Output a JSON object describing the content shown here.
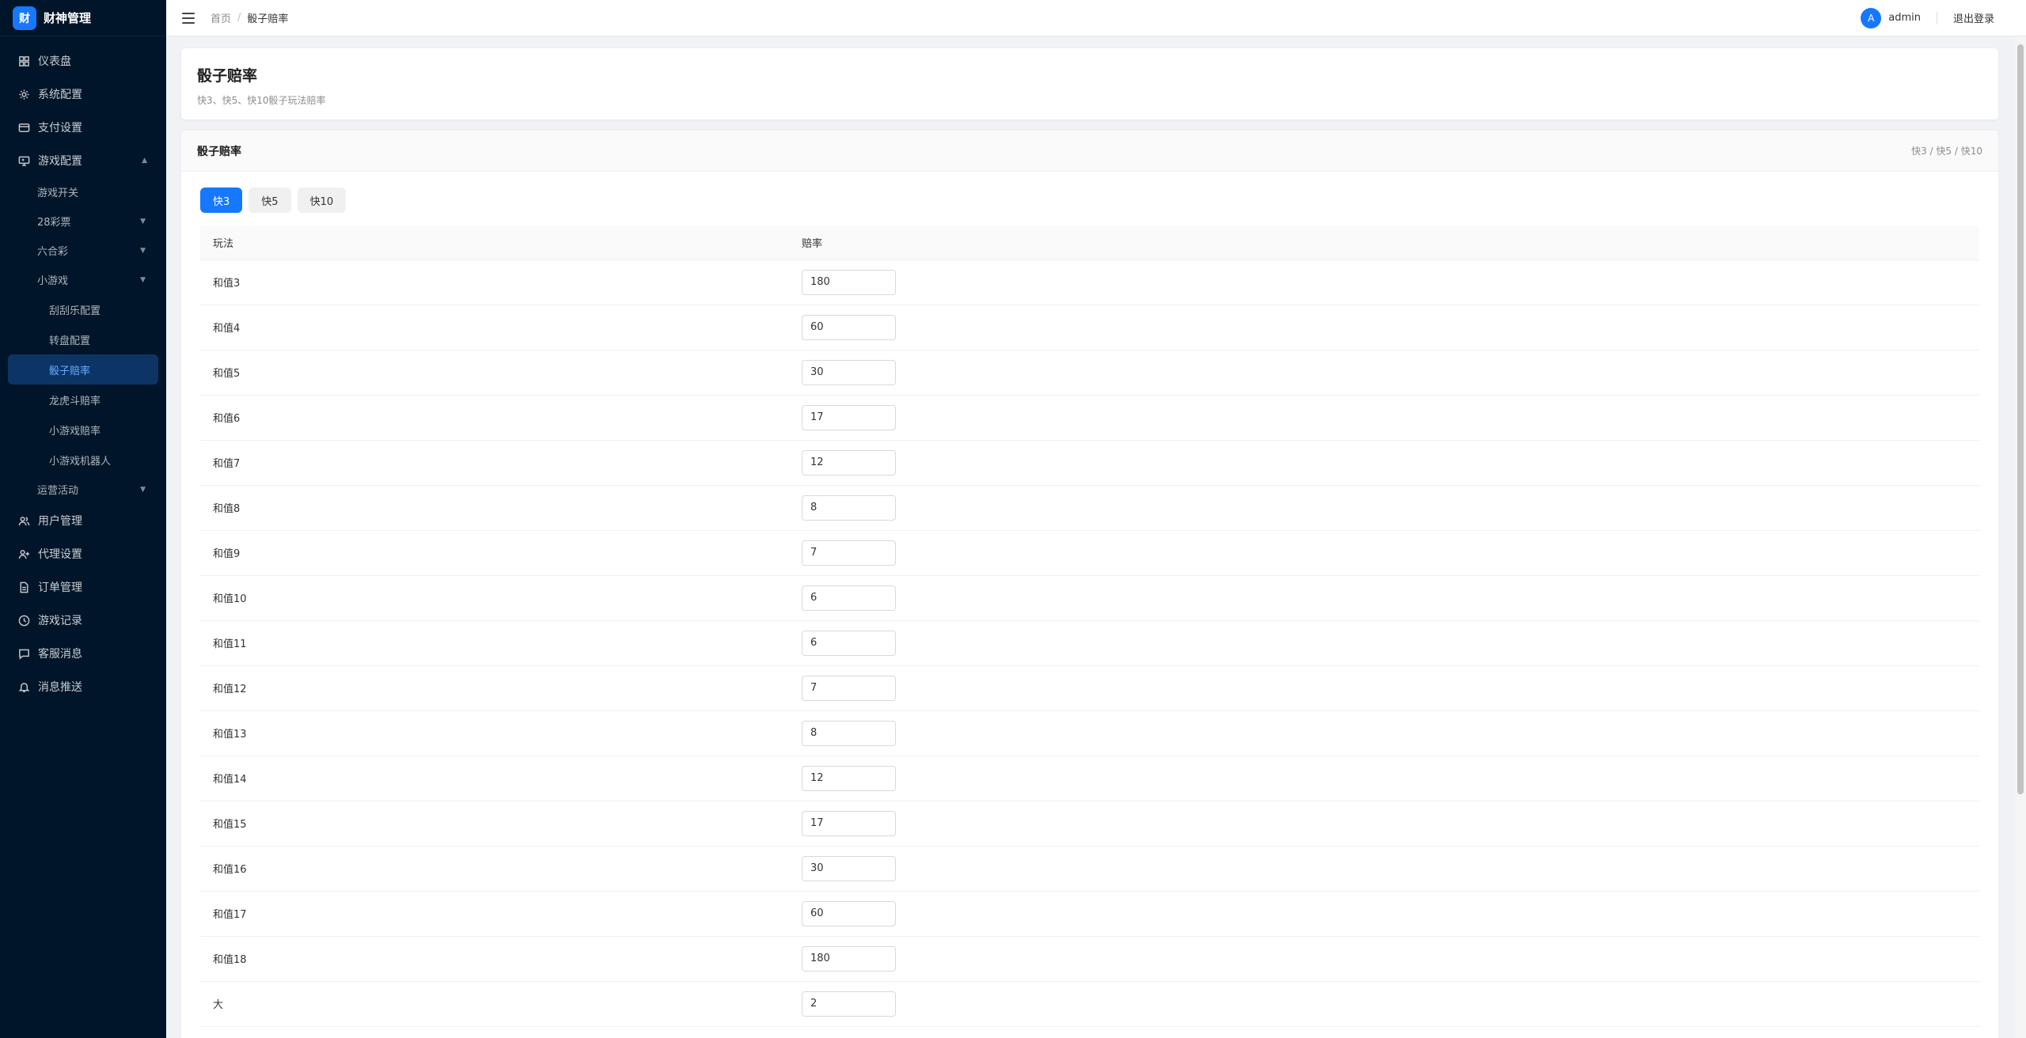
{
  "brand": {
    "logo_char": "财",
    "name": "财神管理"
  },
  "sidebar": {
    "top_items": [
      {
        "label": "仪表盘",
        "icon": "dashboard-icon"
      },
      {
        "label": "系统配置",
        "icon": "gear-icon"
      },
      {
        "label": "支付设置",
        "icon": "credit-card-icon"
      },
      {
        "label": "游戏配置",
        "icon": "monitor-icon"
      }
    ],
    "game_sub": {
      "switch": "游戏开关",
      "lottery28": "28彩票",
      "mark_six": "六合彩",
      "mini_games": "小游戏",
      "mini_children": [
        "刮刮乐配置",
        "转盘配置",
        "骰子赔率",
        "龙虎斗赔率",
        "小游戏赔率",
        "小游戏机器人"
      ],
      "events": "运营活动"
    },
    "bottom_items": [
      {
        "label": "用户管理",
        "icon": "users-icon"
      },
      {
        "label": "代理设置",
        "icon": "user-plus-icon"
      },
      {
        "label": "订单管理",
        "icon": "document-icon"
      },
      {
        "label": "游戏记录",
        "icon": "clock-icon"
      },
      {
        "label": "客服消息",
        "icon": "chat-icon"
      },
      {
        "label": "消息推送",
        "icon": "bell-icon"
      }
    ]
  },
  "topbar": {
    "breadcrumb_home": "首页",
    "breadcrumb_sep": "/",
    "breadcrumb_current": "骰子赔率",
    "avatar_letter": "A",
    "user_name": "admin",
    "logout": "退出登录"
  },
  "header": {
    "title": "骰子赔率",
    "subtitle": "快3、快5、快10骰子玩法赔率"
  },
  "panel": {
    "title": "骰子赔率",
    "extra": "快3 / 快5 / 快10",
    "tabs": [
      "快3",
      "快5",
      "快10"
    ],
    "columns": [
      "玩法",
      "赔率"
    ],
    "rows": [
      {
        "play": "和值3",
        "odds": "180"
      },
      {
        "play": "和值4",
        "odds": "60"
      },
      {
        "play": "和值5",
        "odds": "30"
      },
      {
        "play": "和值6",
        "odds": "17"
      },
      {
        "play": "和值7",
        "odds": "12"
      },
      {
        "play": "和值8",
        "odds": "8"
      },
      {
        "play": "和值9",
        "odds": "7"
      },
      {
        "play": "和值10",
        "odds": "6"
      },
      {
        "play": "和值11",
        "odds": "6"
      },
      {
        "play": "和值12",
        "odds": "7"
      },
      {
        "play": "和值13",
        "odds": "8"
      },
      {
        "play": "和值14",
        "odds": "12"
      },
      {
        "play": "和值15",
        "odds": "17"
      },
      {
        "play": "和值16",
        "odds": "30"
      },
      {
        "play": "和值17",
        "odds": "60"
      },
      {
        "play": "和值18",
        "odds": "180"
      },
      {
        "play": "大",
        "odds": "2"
      }
    ]
  },
  "colors": {
    "sidebar_bg": "#001529",
    "primary": "#1677ff",
    "active_menu_bg": "#0c3566"
  }
}
